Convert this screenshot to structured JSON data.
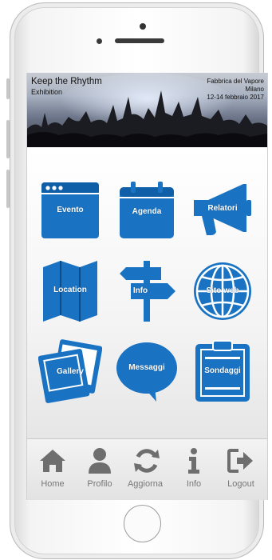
{
  "colors": {
    "accent": "#1a73c2",
    "tab_icon": "#6e6e6e",
    "tab_label": "#777777"
  },
  "banner": {
    "title": "Keep the Rhythm",
    "subtitle": "Exhibition",
    "venue_line1": "Fabbrica del Vapore",
    "venue_line2": "Milano",
    "venue_line3": "12-14 febbraio 2017"
  },
  "tiles": [
    {
      "label": "Evento",
      "icon": "browser-window-icon"
    },
    {
      "label": "Agenda",
      "icon": "calendar-icon"
    },
    {
      "label": "Relatori",
      "icon": "megaphone-icon"
    },
    {
      "label": "Location",
      "icon": "map-icon"
    },
    {
      "label": "Info",
      "icon": "signpost-icon"
    },
    {
      "label": "Sito web",
      "icon": "globe-icon"
    },
    {
      "label": "Gallery",
      "icon": "photos-icon"
    },
    {
      "label": "Messaggi",
      "icon": "speech-bubble-icon"
    },
    {
      "label": "Sondaggi",
      "icon": "clipboard-icon"
    }
  ],
  "tabbar": [
    {
      "label": "Home",
      "icon": "home-icon"
    },
    {
      "label": "Profilo",
      "icon": "user-icon"
    },
    {
      "label": "Aggiorna",
      "icon": "refresh-icon"
    },
    {
      "label": "Info",
      "icon": "info-icon"
    },
    {
      "label": "Logout",
      "icon": "logout-icon"
    }
  ]
}
